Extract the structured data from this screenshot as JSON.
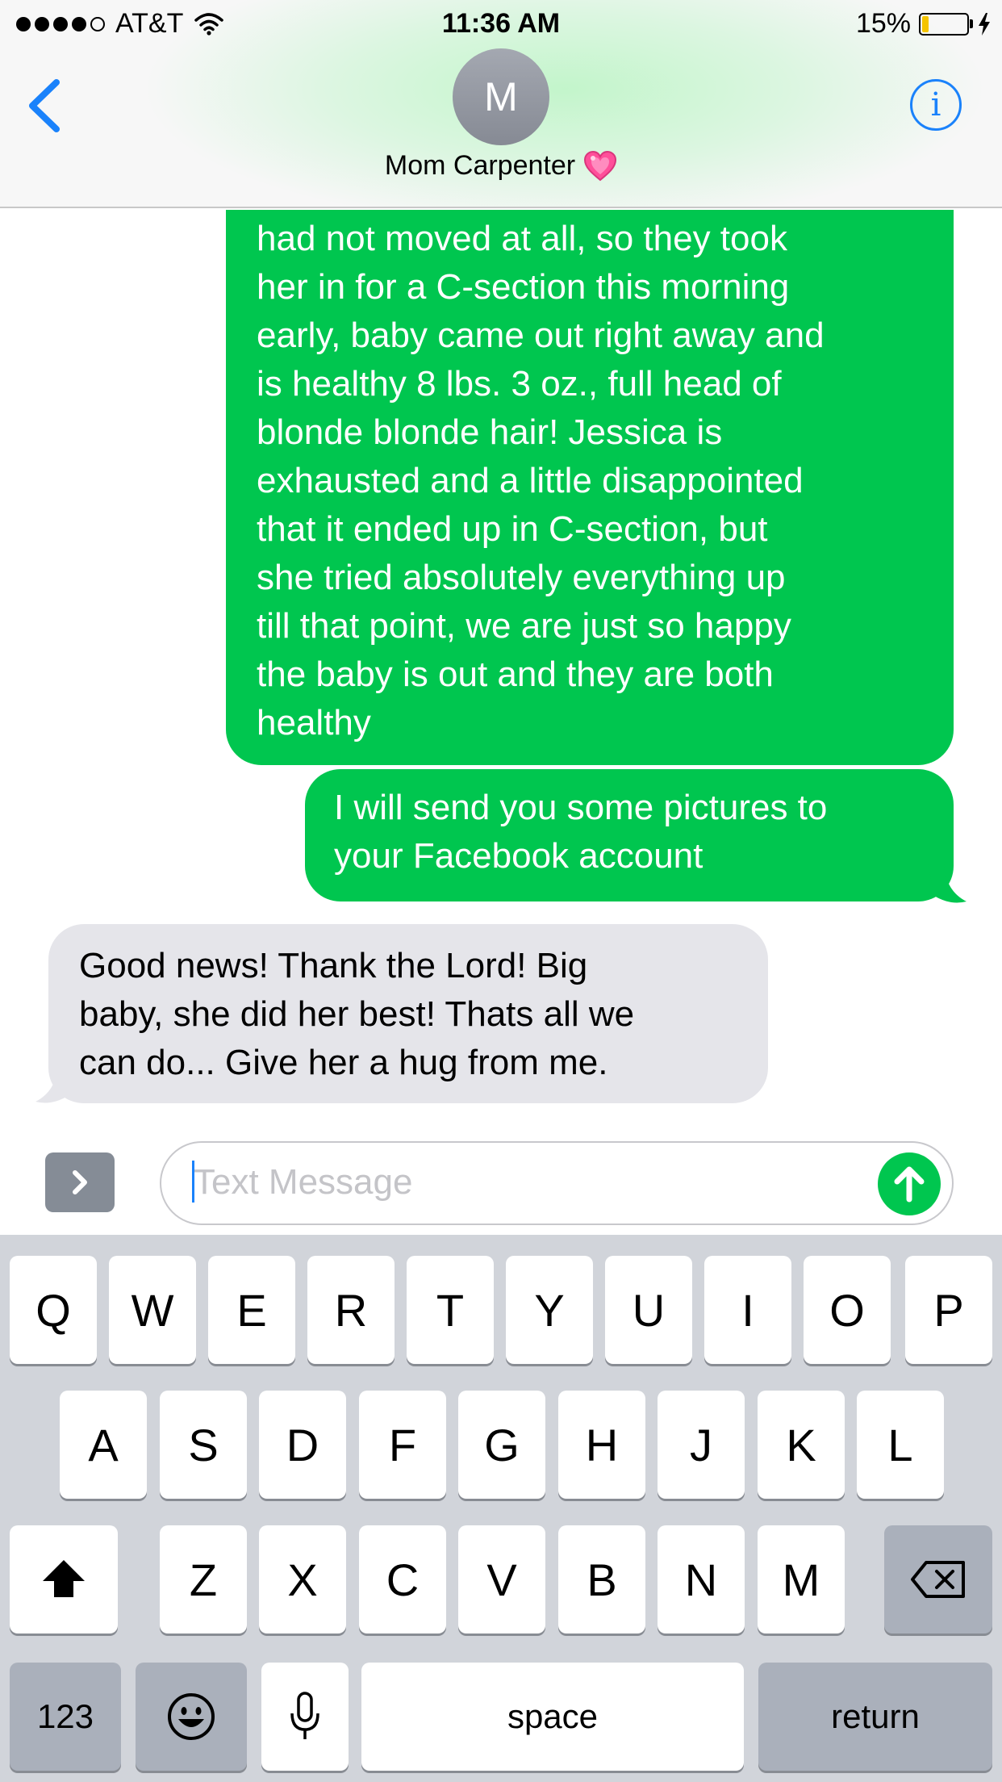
{
  "status_bar": {
    "carrier": "AT&T",
    "time": "11:36 AM",
    "battery_percent": "15%",
    "battery_level": 0.15,
    "icons": [
      "signal-dots-icon",
      "wifi-icon",
      "battery-icon",
      "charging-bolt-icon"
    ]
  },
  "header": {
    "avatar_initial": "M",
    "contact_name": "Mom Carpenter",
    "icons": [
      "back-chevron-icon",
      "heart-emoji-icon",
      "info-icon"
    ],
    "info_symbol": "i"
  },
  "messages": [
    {
      "direction": "sent",
      "lines": [
        "had not moved at all, so they took",
        "her in for a C-section this morning",
        "early, baby came out right away and",
        "is healthy 8 lbs. 3 oz., full head of",
        "blonde blonde hair! Jessica is",
        "exhausted and a little disappointed",
        "that it ended up in C-section, but",
        "she tried absolutely everything up",
        "till that point, we are just so happy",
        "the baby is out and they are both",
        "healthy"
      ]
    },
    {
      "direction": "sent",
      "lines": [
        "I will send you some pictures to",
        "your Facebook account"
      ]
    },
    {
      "direction": "received",
      "lines": [
        "Good news! Thank the Lord! Big",
        "baby, she did her best! Thats all we",
        "can do... Give her a hug from me."
      ]
    }
  ],
  "composer": {
    "placeholder": "Text Message",
    "icons": [
      "expand-apps-icon",
      "send-arrow-icon"
    ]
  },
  "keyboard": {
    "row1": [
      "Q",
      "W",
      "E",
      "R",
      "T",
      "Y",
      "U",
      "I",
      "O",
      "P"
    ],
    "row2": [
      "A",
      "S",
      "D",
      "F",
      "G",
      "H",
      "J",
      "K",
      "L"
    ],
    "row3": [
      "Z",
      "X",
      "C",
      "V",
      "B",
      "N",
      "M"
    ],
    "numbers_label": "123",
    "space_label": "space",
    "return_label": "return",
    "icons": [
      "shift-icon",
      "backspace-icon",
      "emoji-icon",
      "microphone-icon"
    ]
  },
  "colors": {
    "sent_bubble": "#00c64f",
    "received_bubble": "#e5e5ea",
    "accent_blue": "#1a82fb",
    "keyboard_bg": "#d1d4da",
    "battery_fill": "#f5c400"
  }
}
